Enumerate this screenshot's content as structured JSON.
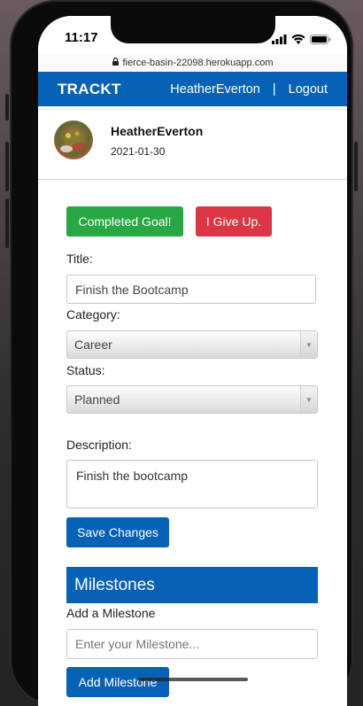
{
  "device": {
    "time": "11:17",
    "status_icons": [
      "signal-icon",
      "wifi-icon",
      "battery-icon"
    ]
  },
  "browser": {
    "url": "fierce-basin-22098.herokuapp.com",
    "lock_icon": "lock-icon"
  },
  "navbar": {
    "brand": "TRACKT",
    "username": "HeatherEverton",
    "separator": "|",
    "logout": "Logout"
  },
  "profile": {
    "name": "HeatherEverton",
    "date": "2021-01-30"
  },
  "actions": {
    "complete": "Completed Goal!",
    "give_up": "I Give Up."
  },
  "form": {
    "title_label": "Title:",
    "title_value": "Finish the Bootcamp",
    "category_label": "Category:",
    "category_value": "Career",
    "status_label": "Status:",
    "status_value": "Planned",
    "description_label": "Description:",
    "description_value": "Finish the bootcamp",
    "save_label": "Save Changes"
  },
  "milestones": {
    "header": "Milestones",
    "add_label": "Add a Milestone",
    "input_placeholder": "Enter your Milestone...",
    "add_button": "Add Milestone"
  },
  "colors": {
    "primary": "#0761b5",
    "success": "#28a745",
    "danger": "#dc3545"
  }
}
